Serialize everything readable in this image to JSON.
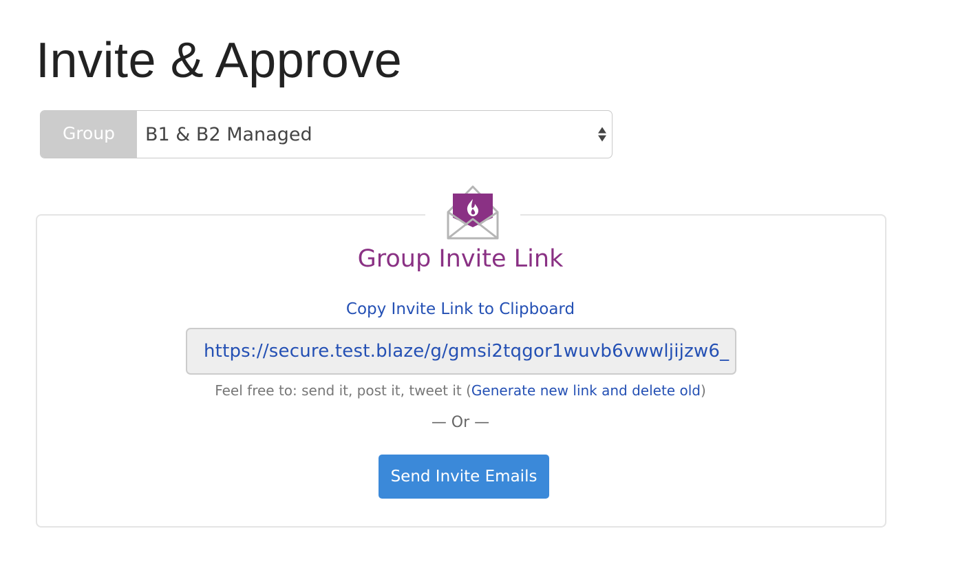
{
  "page": {
    "title": "Invite & Approve"
  },
  "group_picker": {
    "label": "Group",
    "selected": "B1 & B2 Managed"
  },
  "invite_card": {
    "icon": "envelope-flame-icon",
    "title": "Group Invite Link",
    "copy_link_label": "Copy Invite Link to Clipboard",
    "invite_url": "https://secure.test.blaze/g/gmsi2tqgor1wuvb6vwwljijzw6_",
    "share_prefix": "Feel free to: send it, post it, tweet it (",
    "regenerate_label": "Generate new link and delete old",
    "share_suffix": ")",
    "separator": "— Or —",
    "send_button_label": "Send Invite Emails"
  },
  "colors": {
    "brand_purple": "#8a3184",
    "link_blue": "#2450b4",
    "button_blue": "#3b89d9",
    "label_gray": "#cccccc"
  }
}
